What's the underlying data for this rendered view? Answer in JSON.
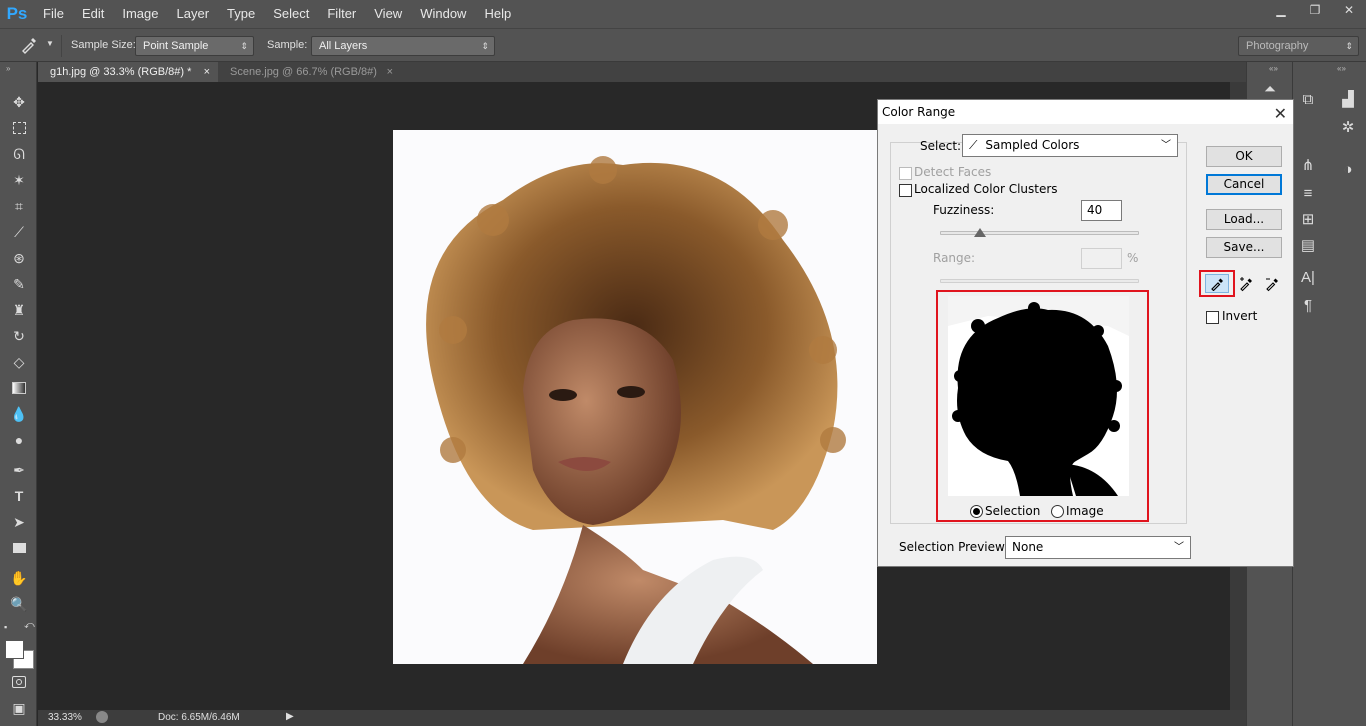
{
  "app": {
    "logo": "Ps"
  },
  "menu": [
    "File",
    "Edit",
    "Image",
    "Layer",
    "Type",
    "Select",
    "Filter",
    "View",
    "Window",
    "Help"
  ],
  "options": {
    "sample_size_label": "Sample Size:",
    "sample_size_value": "Point Sample",
    "sample_label": "Sample:",
    "sample_value": "All Layers",
    "workspace": "Photography"
  },
  "tabs": [
    {
      "label": "g1h.jpg @ 33.3% (RGB/8#) *",
      "close": "×",
      "active": true
    },
    {
      "label": "Scene.jpg @ 66.7% (RGB/8#)",
      "close": "×",
      "active": false
    }
  ],
  "status": {
    "zoom": "33.33%",
    "doc": "Doc: 6.65M/6.46M"
  },
  "dialog": {
    "title": "Color Range",
    "close": "✕",
    "select_label": "Select:",
    "select_value": "Sampled Colors",
    "detect_faces": "Detect Faces",
    "localized_clusters": "Localized Color Clusters",
    "fuzziness_label": "Fuzziness:",
    "fuzziness_value": "40",
    "fuzziness_level": 0.2,
    "range_label": "Range:",
    "range_unit": "%",
    "selection_radio": "Selection",
    "image_radio": "Image",
    "preview_label": "Selection Preview:",
    "preview_value": "None",
    "ok": "OK",
    "cancel": "Cancel",
    "load": "Load...",
    "save": "Save...",
    "invert": "Invert"
  },
  "colors": {
    "highlight": "#e0141e",
    "accent_blue": "#0078d7",
    "ps_blue": "#31a8ff"
  }
}
